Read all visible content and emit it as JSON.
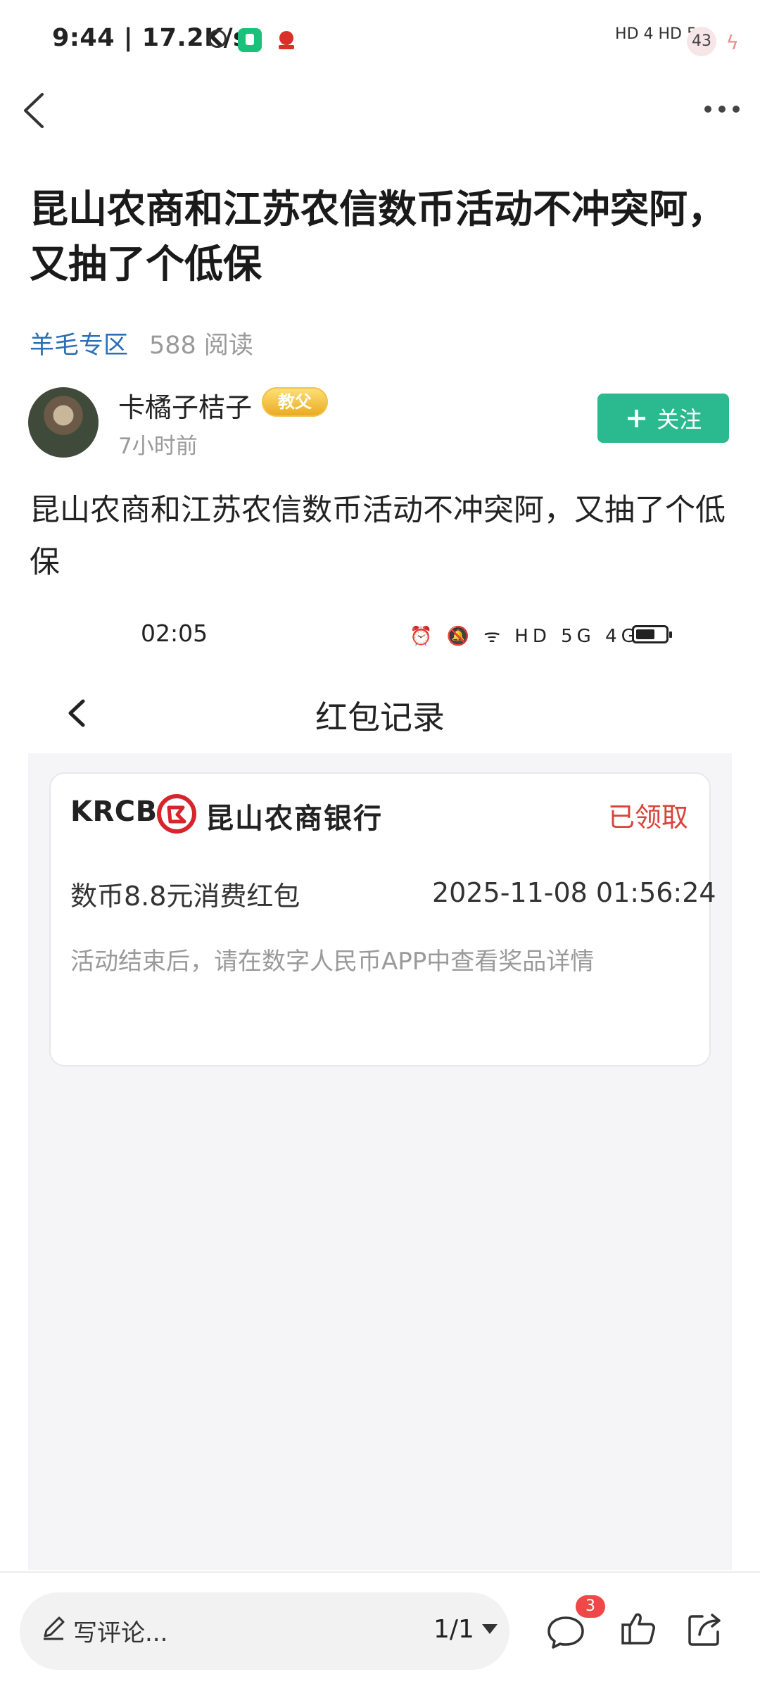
{
  "status_bar": {
    "time": "9:44",
    "speed": "17.2K/s",
    "right_text": "HD 4 HD 5",
    "battery": "43"
  },
  "article": {
    "title": "昆山农商和江苏农信数币活动不冲突阿，又抽了个低保",
    "category": "羊毛专区",
    "reads": "588 阅读",
    "author": "卡橘子桔子",
    "author_badge": "教父",
    "post_time": "7小时前",
    "follow_label": "关注",
    "body": "昆山农商和江苏农信数币活动不冲突阿，又抽了个低保"
  },
  "screenshot": {
    "time": "02:05",
    "status_icons": "⏰ 🔕 ᯤ HD 5G 4G",
    "page_title": "红包记录",
    "card": {
      "brand": "KRCB",
      "bank_name": "昆山农商银行",
      "status": "已领取",
      "reward": "数币8.8元消费红包",
      "reward_time": "2025-11-08 01:56:24",
      "note": "活动结束后，请在数字人民币APP中查看奖品详情"
    }
  },
  "bottom_bar": {
    "comment_placeholder": "写评论...",
    "pager": "1/1",
    "comment_count": "3"
  },
  "icons": {
    "back": "chevron-left-icon",
    "more": "more-dots-icon",
    "pencil": "pencil-icon",
    "comment": "comment-bubble-icon",
    "like": "thumbs-up-icon",
    "share": "share-icon"
  },
  "colors": {
    "accent_green": "#2bb98f",
    "category_blue": "#2c6db5",
    "claimed_red": "#d9433a",
    "badge_red": "#f04848"
  }
}
